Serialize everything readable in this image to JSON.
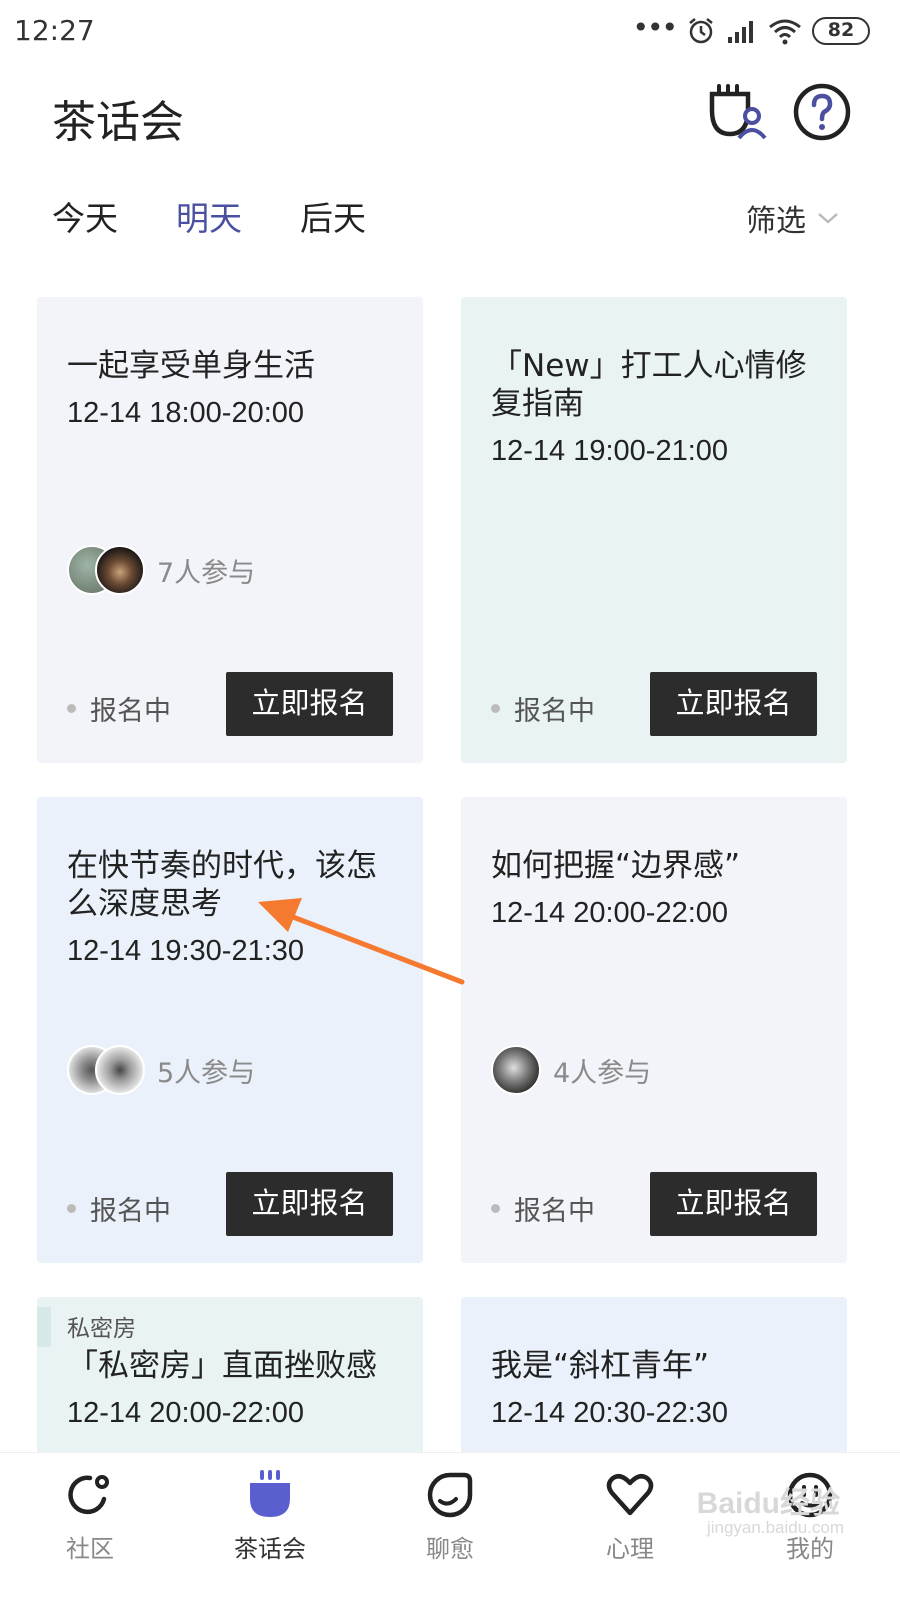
{
  "status_bar": {
    "time": "12:27",
    "battery": "82"
  },
  "header": {
    "title": "茶话会",
    "tea_icon": "tea-cup-user-icon",
    "help_icon": "help-question-icon"
  },
  "tabs": [
    {
      "label": "今天",
      "active": false
    },
    {
      "label": "明天",
      "active": true
    },
    {
      "label": "后天",
      "active": false
    }
  ],
  "filter": {
    "label": "筛选"
  },
  "cards": [
    {
      "title": "一起享受单身生活",
      "time": "12-14 18:00-20:00",
      "participants": "7人参与",
      "status": "报名中",
      "button": "立即报名"
    },
    {
      "title": "「New」打工人心情修复指南",
      "time": "12-14 19:00-21:00",
      "status": "报名中",
      "button": "立即报名"
    },
    {
      "title": "在快节奏的时代，该怎么深度思考",
      "time": "12-14 19:30-21:30",
      "participants": "5人参与",
      "status": "报名中",
      "button": "立即报名"
    },
    {
      "title": "如何把握“边界感”",
      "time": "12-14 20:00-22:00",
      "participants": "4人参与",
      "status": "报名中",
      "button": "立即报名"
    },
    {
      "tag": "私密房",
      "title": "「私密房」直面挫败感",
      "time": "12-14 20:00-22:00"
    },
    {
      "title": "我是“斜杠青年”",
      "time": "12-14 20:30-22:30"
    }
  ],
  "bottom_nav": [
    {
      "label": "社区",
      "icon": "community-icon",
      "active": false
    },
    {
      "label": "茶话会",
      "icon": "tea-party-icon",
      "active": true
    },
    {
      "label": "聊愈",
      "icon": "chat-heal-icon",
      "active": false
    },
    {
      "label": "心理",
      "icon": "heart-icon",
      "active": false
    },
    {
      "label": "我的",
      "icon": "smiley-icon",
      "active": false
    }
  ],
  "watermark": {
    "brand": "Baidu经验",
    "url": "jingyan.baidu.com"
  },
  "colors": {
    "accent": "#4a4fa0",
    "button_bg": "#2c2c2c",
    "nav_active": "#5a5fd0",
    "annotation_arrow": "#f5792f"
  }
}
